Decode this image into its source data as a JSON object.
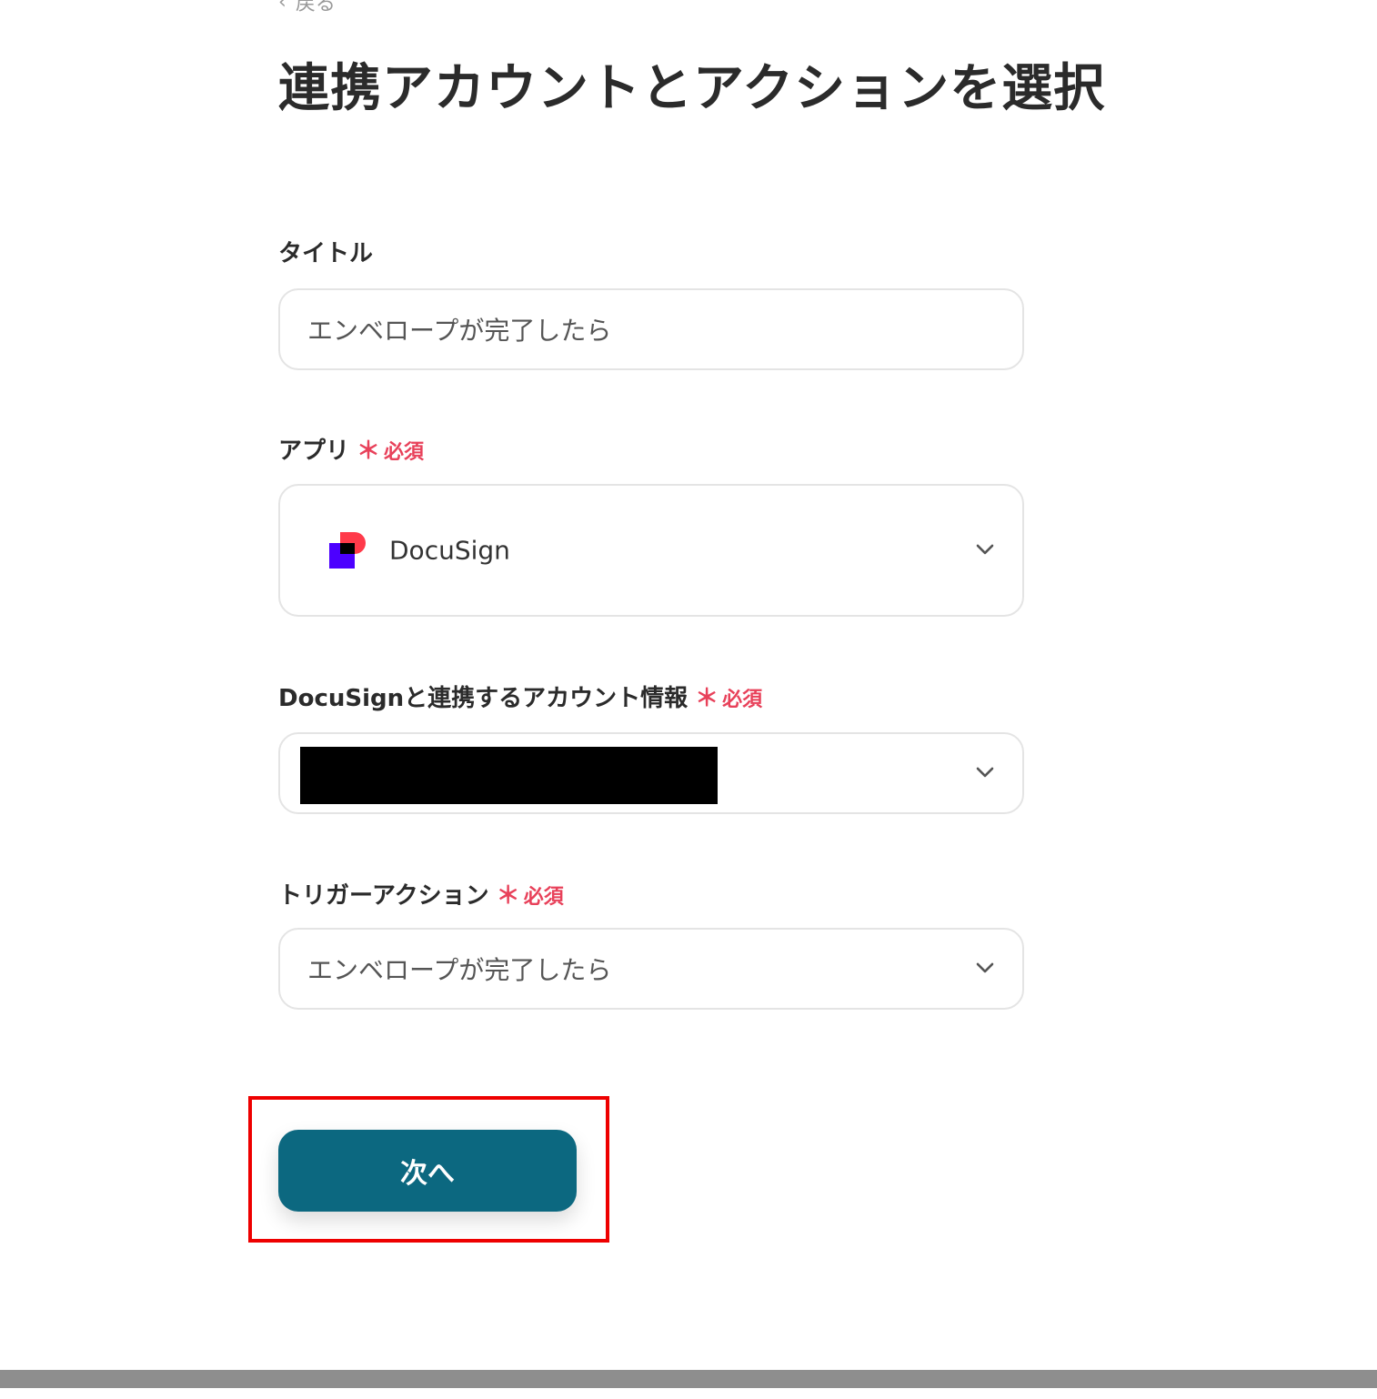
{
  "header": {
    "back_label": "戻る",
    "title": "連携アカウントとアクションを選択"
  },
  "form": {
    "title_field": {
      "label": "タイトル",
      "value": "エンベロープが完了したら"
    },
    "app_field": {
      "label": "アプリ",
      "required_label": "必須",
      "value": "DocuSign",
      "icon": "docusign-logo"
    },
    "account_field": {
      "label": "DocuSignと連携するアカウント情報",
      "required_label": "必須",
      "value_redacted": true
    },
    "trigger_field": {
      "label": "トリガーアクション",
      "required_label": "必須",
      "value": "エンベロープが完了したら"
    },
    "required_marker": "＊"
  },
  "actions": {
    "next_label": "次へ"
  },
  "colors": {
    "primary": "#0c6880",
    "required": "#e8415a",
    "highlight": "#ee0000"
  }
}
